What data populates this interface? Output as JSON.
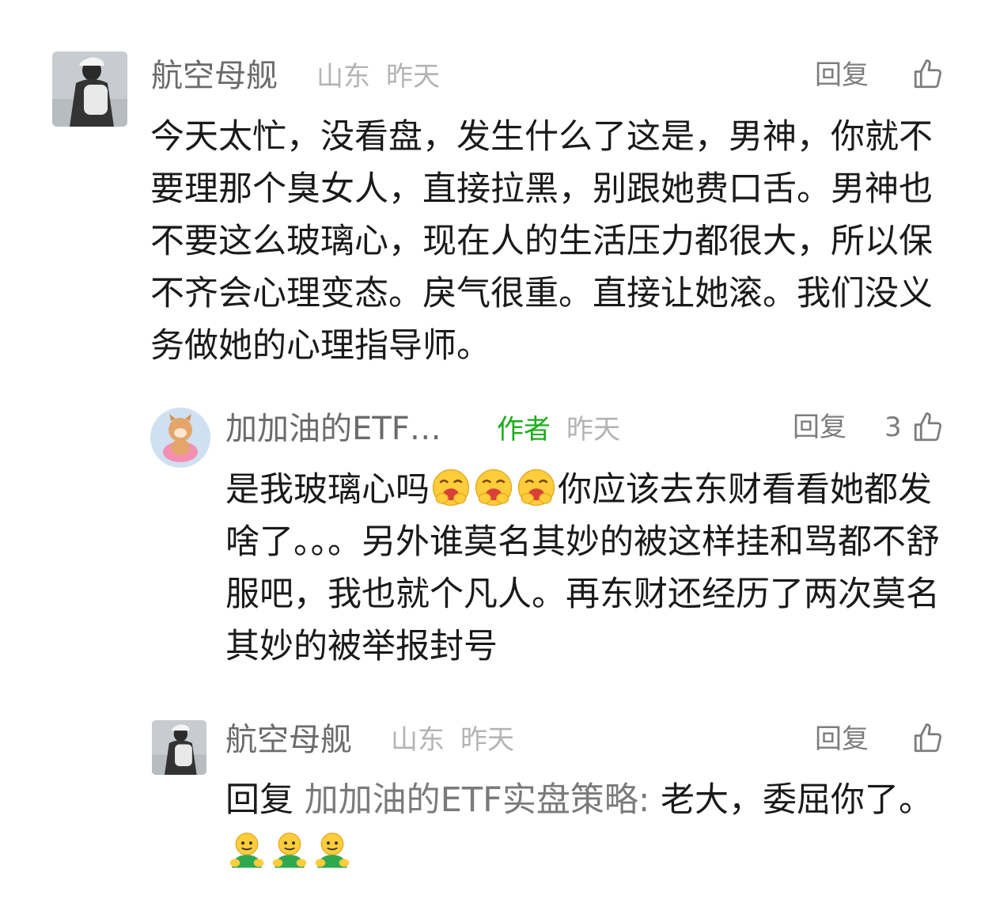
{
  "comments": [
    {
      "name": "航空母舰",
      "location": "山东",
      "time": "昨天",
      "reply_label": "回复",
      "text": "今天太忙，没看盘，发生什么了这是，男神，你就不要理那个臭女人，直接拉黑，别跟她费口舌。男神也不要这么玻璃心，现在人的生活压力都很大，所以保不齐会心理变态。戾气很重。直接让她滚。我们没义务做她的心理指导师。"
    },
    {
      "name": "加加油的ETF…",
      "author_badge": "作者",
      "time": "昨天",
      "reply_label": "回复",
      "like_count": "3",
      "text_part1": "是我玻璃心吗",
      "emoji": "giggle-emoji",
      "text_part2": "你应该去东财看看她都发啥了。。。另外谁莫名其妙的被这样挂和骂都不舒服吧，我也就个凡人。再东财还经历了两次莫名其妙的被举报封号"
    },
    {
      "name": "航空母舰",
      "location": "山东",
      "time": "昨天",
      "reply_label": "回复",
      "reply_prefix": "回复 ",
      "reply_target": "加加油的ETF实盘策略:",
      "text": " 老大，委屈你了。",
      "emoji": "green-person-emoji"
    }
  ],
  "colors": {
    "author_green": "#1aad19",
    "meta_gray": "#b4b4b4",
    "name_gray": "#6b6b6b"
  }
}
